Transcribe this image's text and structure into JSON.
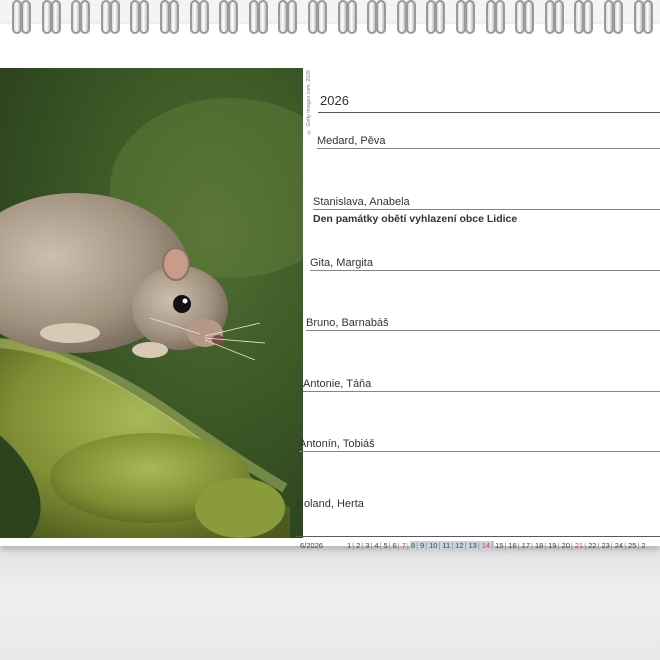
{
  "year": "2026",
  "photo_credit": "© Getty Images.com, 2025",
  "days": [
    {
      "name": "Medard, Pěva",
      "holiday": ""
    },
    {
      "name": "Stanislava, Anabela",
      "holiday": "Den památky obětí vyhlazení obce Lidice"
    },
    {
      "name": "Gita, Margita",
      "holiday": ""
    },
    {
      "name": "Bruno, Barnabáš",
      "holiday": ""
    },
    {
      "name": "Antonie, Táňa",
      "holiday": ""
    },
    {
      "name": "Antonín, Tobiáš",
      "holiday": ""
    },
    {
      "name": "Roland, Herta",
      "holiday": ""
    }
  ],
  "month_strip": {
    "label": "6/2026",
    "days": [
      "1",
      "2",
      "3",
      "4",
      "5",
      "6",
      "7",
      "8",
      "9",
      "10",
      "11",
      "12",
      "13",
      "14",
      "15",
      "16",
      "17",
      "18",
      "19",
      "20",
      "21",
      "22",
      "23",
      "24",
      "25",
      "2"
    ],
    "sundays": [
      "7",
      "14",
      "21"
    ],
    "highlighted": [
      "8",
      "9",
      "10",
      "11",
      "12",
      "13",
      "14"
    ]
  },
  "colors": {
    "rule": "#445a6e",
    "sunday": "#d43b3b",
    "week_highlight": "#c9d2de"
  }
}
